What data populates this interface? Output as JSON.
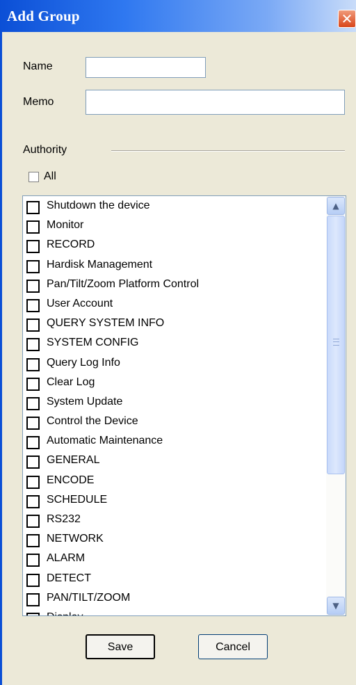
{
  "window": {
    "title": "Add Group",
    "close_label": "✕"
  },
  "form": {
    "name_label": "Name",
    "name_value": "",
    "memo_label": "Memo",
    "memo_value": ""
  },
  "authority": {
    "label": "Authority",
    "all_label": "All",
    "all_checked": false,
    "items": [
      {
        "label": "Shutdown the device",
        "checked": false
      },
      {
        "label": "Monitor",
        "checked": false
      },
      {
        "label": "RECORD",
        "checked": false
      },
      {
        "label": "Hardisk Management",
        "checked": false
      },
      {
        "label": "Pan/Tilt/Zoom Platform Control",
        "checked": false
      },
      {
        "label": "User Account",
        "checked": false
      },
      {
        "label": "QUERY SYSTEM INFO",
        "checked": false
      },
      {
        "label": "SYSTEM CONFIG",
        "checked": false
      },
      {
        "label": "Query Log Info",
        "checked": false
      },
      {
        "label": "Clear Log",
        "checked": false
      },
      {
        "label": "System Update",
        "checked": false
      },
      {
        "label": "Control the Device",
        "checked": false
      },
      {
        "label": "Automatic Maintenance",
        "checked": false
      },
      {
        "label": "GENERAL",
        "checked": false
      },
      {
        "label": "ENCODE",
        "checked": false
      },
      {
        "label": "SCHEDULE",
        "checked": false
      },
      {
        "label": "RS232",
        "checked": false
      },
      {
        "label": "NETWORK",
        "checked": false
      },
      {
        "label": "ALARM",
        "checked": false
      },
      {
        "label": "DETECT",
        "checked": false
      },
      {
        "label": "PAN/TILT/ZOOM",
        "checked": false
      },
      {
        "label": "Display",
        "checked": false
      }
    ]
  },
  "scrollbar": {
    "up_icon": "▲",
    "down_icon": "▼"
  },
  "buttons": {
    "save": "Save",
    "cancel": "Cancel"
  }
}
